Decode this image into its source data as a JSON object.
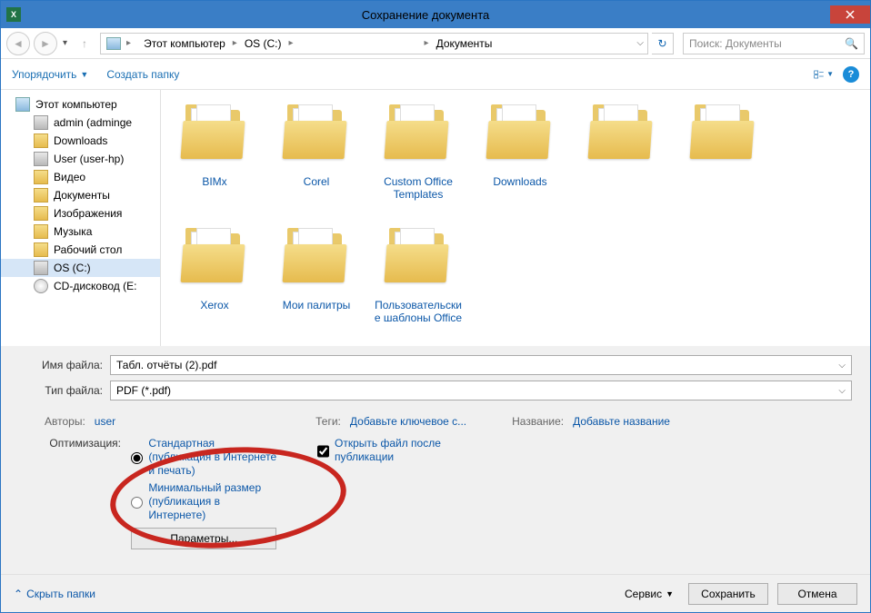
{
  "window": {
    "title": "Сохранение документа"
  },
  "nav": {
    "breadcrumb": [
      "Этот компьютер",
      "OS (C:)",
      "",
      "Документы"
    ],
    "search_placeholder": "Поиск: Документы"
  },
  "toolbar": {
    "organize": "Упорядочить",
    "new_folder": "Создать папку"
  },
  "sidebar": {
    "items": [
      {
        "label": "Этот компьютер",
        "icon": "pc",
        "lvl": 1
      },
      {
        "label": "admin (adminge",
        "icon": "drive",
        "lvl": 2
      },
      {
        "label": "Downloads",
        "icon": "fold",
        "lvl": 2
      },
      {
        "label": "User (user-hp)",
        "icon": "drive",
        "lvl": 2
      },
      {
        "label": "Видео",
        "icon": "fold",
        "lvl": 2
      },
      {
        "label": "Документы",
        "icon": "fold",
        "lvl": 2
      },
      {
        "label": "Изображения",
        "icon": "fold",
        "lvl": 2
      },
      {
        "label": "Музыка",
        "icon": "fold",
        "lvl": 2
      },
      {
        "label": "Рабочий стол",
        "icon": "fold",
        "lvl": 2
      },
      {
        "label": "OS (C:)",
        "icon": "drive",
        "lvl": 2,
        "selected": true
      },
      {
        "label": "CD-дисковод (E:",
        "icon": "disc",
        "lvl": 2
      }
    ]
  },
  "folders": [
    "BIMx",
    "Corel",
    "Custom Office Templates",
    "Downloads",
    "",
    "",
    "Xerox",
    "Мои палитры",
    "Пользовательские шаблоны Office"
  ],
  "filename_label": "Имя файла:",
  "filetype_label": "Тип файла:",
  "filename": "Табл. отчёты (2).pdf",
  "filetype": "PDF (*.pdf)",
  "meta": {
    "authors_label": "Авторы:",
    "authors_value": "user",
    "tags_label": "Теги:",
    "tags_value": "Добавьте ключевое с...",
    "title_label": "Название:",
    "title_value": "Добавьте название"
  },
  "opt": {
    "label": "Оптимизация:",
    "standard": "Стандартная (публикация в Интернете и печать)",
    "minimum": "Минимальный размер (публикация в Интернете)",
    "params": "Параметры...",
    "open_after": "Открыть файл после публикации"
  },
  "footer": {
    "hide": "Скрыть папки",
    "service": "Сервис",
    "save": "Сохранить",
    "cancel": "Отмена"
  }
}
